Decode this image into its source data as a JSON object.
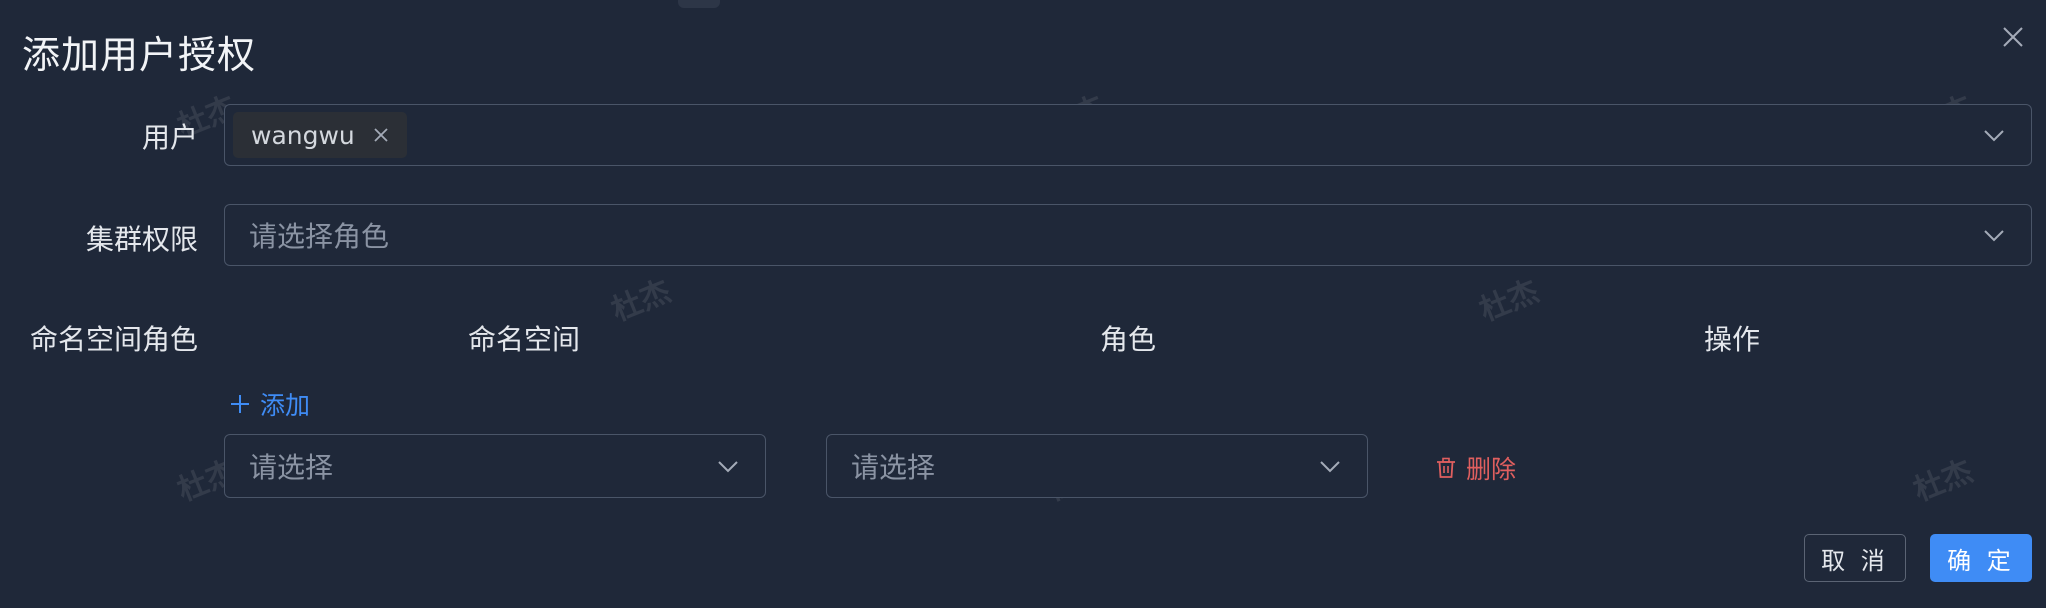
{
  "dialog": {
    "title": "添加用户授权"
  },
  "form": {
    "user_label": "用户",
    "user_tag": "wangwu",
    "cluster_label": "集群权限",
    "cluster_placeholder": "请选择角色"
  },
  "namespace_roles": {
    "section_label": "命名空间角色",
    "headers": {
      "namespace": "命名空间",
      "role": "角色",
      "action": "操作"
    },
    "add_label": "添加",
    "rows": [
      {
        "namespace_placeholder": "请选择",
        "role_placeholder": "请选择",
        "delete_label": "删除"
      }
    ]
  },
  "footer": {
    "cancel_label": "取 消",
    "ok_label": "确 定"
  },
  "watermark_text": "杜杰",
  "colors": {
    "background": "#1f2839",
    "primary": "#3f8cf5",
    "danger": "#e05f5f",
    "border": "#4a5568"
  },
  "icons": [
    "close-icon",
    "tag-close-icon",
    "chevron-down-icon",
    "plus-icon",
    "trash-icon"
  ]
}
